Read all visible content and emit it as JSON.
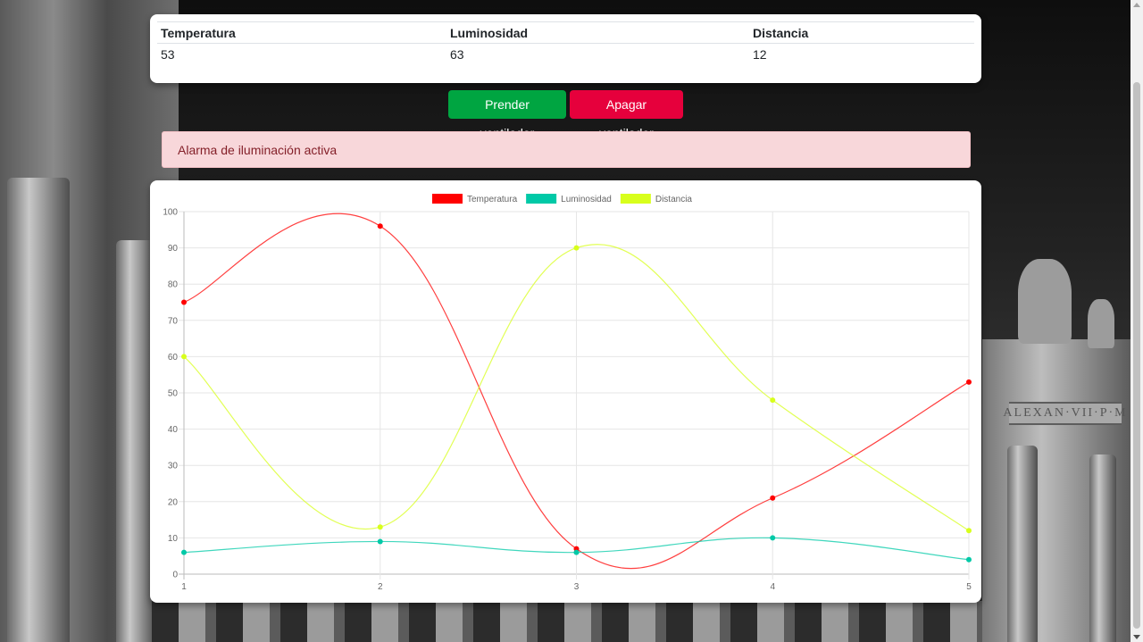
{
  "table": {
    "headers": [
      "Temperatura",
      "Luminosidad",
      "Distancia"
    ],
    "values": [
      "53",
      "63",
      "12"
    ]
  },
  "buttons": {
    "on_label": "Prender ventilador",
    "off_label": "Apagar ventilador"
  },
  "alert": {
    "text": "Alarma de iluminación activa"
  },
  "colors": {
    "temperatura": "#ff0000",
    "luminosidad": "#00c9a7",
    "distancia": "#d8ff1c",
    "btn_on": "#00a541",
    "btn_off": "#e6003c"
  },
  "chart_data": {
    "type": "line",
    "x": [
      1,
      2,
      3,
      4,
      5
    ],
    "ylim": [
      0,
      100
    ],
    "yticks": [
      0,
      10,
      20,
      30,
      40,
      50,
      60,
      70,
      80,
      90,
      100
    ],
    "legend_position": "top",
    "grid": true,
    "series": [
      {
        "name": "Temperatura",
        "values": [
          75,
          96,
          7,
          21,
          53
        ]
      },
      {
        "name": "Luminosidad",
        "values": [
          6,
          9,
          6,
          10,
          4
        ]
      },
      {
        "name": "Distancia",
        "values": [
          60,
          13,
          90,
          48,
          12
        ]
      }
    ]
  }
}
